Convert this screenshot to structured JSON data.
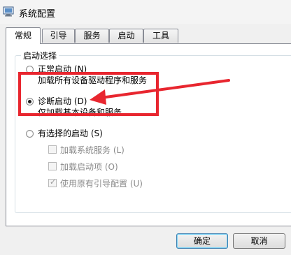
{
  "window": {
    "title": "系统配置"
  },
  "tabs": [
    {
      "label": "常规"
    },
    {
      "label": "引导"
    },
    {
      "label": "服务"
    },
    {
      "label": "启动"
    },
    {
      "label": "工具"
    }
  ],
  "startup": {
    "group_label": "启动选择",
    "options": [
      {
        "label": "正常启动 (N)",
        "description": "加载所有设备驱动程序和服务",
        "selected": false
      },
      {
        "label": "诊断启动 (D)",
        "description": "仅加载基本设备和服务",
        "selected": true
      },
      {
        "label": "有选择的启动 (S)",
        "description": "",
        "selected": false
      }
    ],
    "sub_options": [
      {
        "label": "加载系统服务 (L)",
        "checked": false
      },
      {
        "label": "加载启动项 (O)",
        "checked": false
      },
      {
        "label": "使用原有引导配置 (U)",
        "checked": true
      }
    ]
  },
  "buttons": {
    "ok": "确定",
    "cancel": "取消"
  },
  "colors": {
    "highlight": "#e8262f",
    "arrow": "#e8262f"
  }
}
